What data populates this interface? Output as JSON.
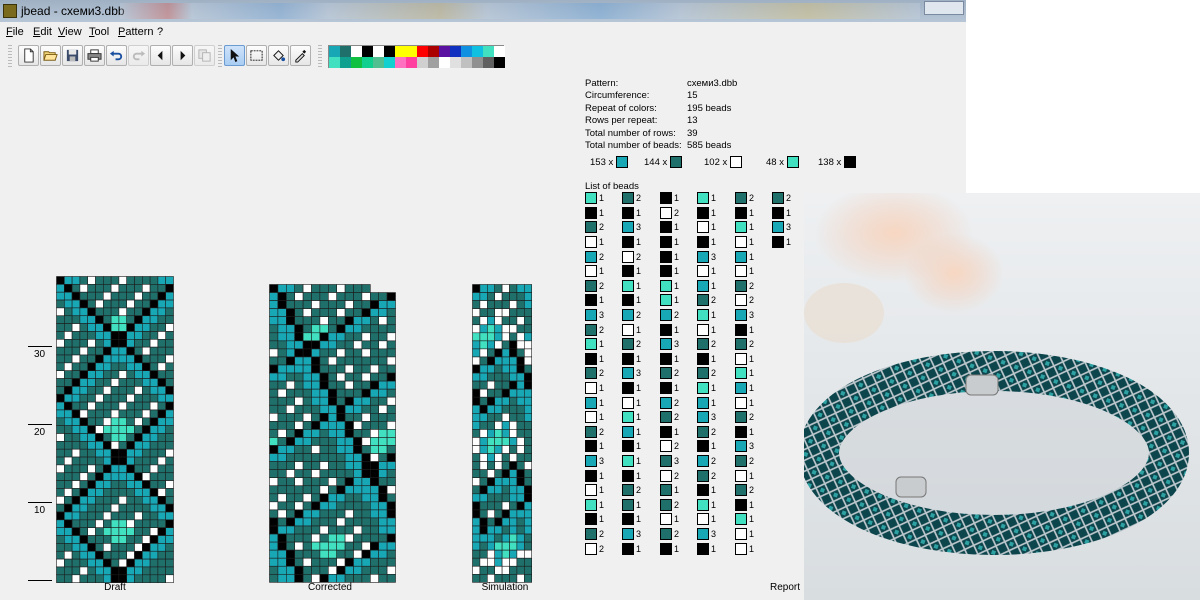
{
  "window": {
    "title": "jbead - схеми3.dbb"
  },
  "menu": [
    "File",
    "Edit",
    "View",
    "Tool",
    "Pattern",
    "?"
  ],
  "toolbar": {
    "buttons": [
      "new",
      "open",
      "save",
      "print",
      "undo",
      "redo",
      "arrow-left",
      "arrow-right",
      "copy",
      "pointer",
      "select",
      "fill",
      "pipette"
    ]
  },
  "palette": [
    "#18a7b5",
    "#1f6f6b",
    "#ffffff",
    "#000000",
    "#ffffff",
    "#000000",
    "#ffff00",
    "#ffff00",
    "#ff0000",
    "#aa0000",
    "#5a10a0",
    "#1030c0",
    "#1090e0",
    "#10c0e0",
    "#40e0c0",
    "#ffffff",
    "#40e0c0",
    "#10a090",
    "#10c040",
    "#10d090",
    "#50c090",
    "#10d0d0",
    "#ff70c0",
    "#ff40a0",
    "#d0d0d0",
    "#a0a0a0",
    "#ffffff",
    "#e0e0e0",
    "#c0c0c0",
    "#909090",
    "#606060",
    "#000000"
  ],
  "colors": {
    "teal": "#18a7b5",
    "darkteal": "#1f6f6b",
    "white": "#ffffff",
    "mint": "#40e0c0",
    "black": "#000000"
  },
  "views": {
    "draft_label": "Draft",
    "corrected_label": "Corrected",
    "simulation_label": "Simulation",
    "report_label": "Report"
  },
  "ruler": [
    "30",
    "20",
    "10"
  ],
  "report": {
    "info": [
      {
        "key": "Pattern:",
        "value": "схеми3.dbb"
      },
      {
        "key": "Circumference:",
        "value": "15"
      },
      {
        "key": "Repeat of colors:",
        "value": "195 beads"
      },
      {
        "key": "Rows per repeat:",
        "value": "13"
      },
      {
        "key": "Total number of rows:",
        "value": "39"
      },
      {
        "key": "Total number of beads:",
        "value": "585 beads"
      }
    ],
    "color_counts": [
      {
        "label": "153 x",
        "color": "#18a7b5"
      },
      {
        "label": "144 x",
        "color": "#1f6f6b"
      },
      {
        "label": "102 x",
        "color": "#ffffff"
      },
      {
        "label": "48 x",
        "color": "#40e0c0"
      },
      {
        "label": "138 x",
        "color": "#000000"
      }
    ],
    "list_title": "List of beads",
    "bead_list": [
      [
        [
          "m",
          1
        ],
        [
          "k",
          1
        ],
        [
          "d",
          2
        ],
        [
          "w",
          1
        ],
        [
          "t",
          2
        ],
        [
          "w",
          1
        ],
        [
          "d",
          2
        ],
        [
          "k",
          1
        ],
        [
          "t",
          3
        ],
        [
          "d",
          2
        ],
        [
          "m",
          1
        ],
        [
          "k",
          1
        ],
        [
          "d",
          2
        ],
        [
          "w",
          1
        ],
        [
          "t",
          1
        ],
        [
          "w",
          1
        ],
        [
          "d",
          2
        ],
        [
          "k",
          1
        ],
        [
          "t",
          3
        ],
        [
          "k",
          1
        ],
        [
          "w",
          1
        ],
        [
          "m",
          1
        ],
        [
          "k",
          1
        ],
        [
          "d",
          2
        ],
        [
          "w",
          2
        ]
      ],
      [
        [
          "d",
          2
        ],
        [
          "k",
          1
        ],
        [
          "t",
          3
        ],
        [
          "k",
          1
        ],
        [
          "w",
          2
        ],
        [
          "k",
          1
        ],
        [
          "m",
          1
        ],
        [
          "k",
          1
        ],
        [
          "t",
          2
        ],
        [
          "w",
          1
        ],
        [
          "d",
          2
        ],
        [
          "k",
          1
        ],
        [
          "t",
          3
        ],
        [
          "k",
          1
        ],
        [
          "w",
          1
        ],
        [
          "m",
          1
        ],
        [
          "t",
          1
        ],
        [
          "k",
          1
        ],
        [
          "m",
          1
        ],
        [
          "k",
          1
        ],
        [
          "d",
          2
        ],
        [
          "d",
          1
        ],
        [
          "k",
          1
        ],
        [
          "t",
          3
        ],
        [
          "k",
          1
        ]
      ],
      [
        [
          "k",
          1
        ],
        [
          "w",
          2
        ],
        [
          "k",
          1
        ],
        [
          "k",
          1
        ],
        [
          "k",
          1
        ],
        [
          "k",
          1
        ],
        [
          "m",
          1
        ],
        [
          "m",
          1
        ],
        [
          "t",
          2
        ],
        [
          "k",
          1
        ],
        [
          "t",
          3
        ],
        [
          "k",
          1
        ],
        [
          "d",
          2
        ],
        [
          "k",
          1
        ],
        [
          "t",
          2
        ],
        [
          "d",
          2
        ],
        [
          "k",
          1
        ],
        [
          "w",
          2
        ],
        [
          "d",
          3
        ],
        [
          "w",
          2
        ],
        [
          "d",
          1
        ],
        [
          "d",
          2
        ],
        [
          "w",
          1
        ],
        [
          "d",
          2
        ],
        [
          "k",
          1
        ]
      ],
      [
        [
          "m",
          1
        ],
        [
          "k",
          1
        ],
        [
          "w",
          1
        ],
        [
          "k",
          1
        ],
        [
          "t",
          3
        ],
        [
          "w",
          1
        ],
        [
          "t",
          1
        ],
        [
          "d",
          2
        ],
        [
          "m",
          1
        ],
        [
          "w",
          1
        ],
        [
          "d",
          2
        ],
        [
          "k",
          1
        ],
        [
          "d",
          2
        ],
        [
          "m",
          1
        ],
        [
          "t",
          1
        ],
        [
          "t",
          3
        ],
        [
          "d",
          2
        ],
        [
          "k",
          1
        ],
        [
          "t",
          2
        ],
        [
          "d",
          2
        ],
        [
          "k",
          1
        ],
        [
          "m",
          1
        ],
        [
          "w",
          1
        ],
        [
          "t",
          3
        ],
        [
          "k",
          1
        ]
      ],
      [
        [
          "d",
          2
        ],
        [
          "k",
          1
        ],
        [
          "m",
          1
        ],
        [
          "w",
          1
        ],
        [
          "t",
          1
        ],
        [
          "w",
          1
        ],
        [
          "d",
          2
        ],
        [
          "w",
          2
        ],
        [
          "t",
          3
        ],
        [
          "k",
          1
        ],
        [
          "d",
          2
        ],
        [
          "w",
          1
        ],
        [
          "m",
          1
        ],
        [
          "t",
          1
        ],
        [
          "w",
          1
        ],
        [
          "d",
          2
        ],
        [
          "k",
          1
        ],
        [
          "t",
          3
        ],
        [
          "d",
          2
        ],
        [
          "w",
          1
        ],
        [
          "d",
          2
        ],
        [
          "k",
          1
        ],
        [
          "m",
          1
        ],
        [
          "w",
          1
        ],
        [
          "w",
          1
        ]
      ],
      [
        [
          "d",
          2
        ],
        [
          "k",
          1
        ],
        [
          "t",
          3
        ],
        [
          "k",
          1
        ]
      ]
    ]
  }
}
